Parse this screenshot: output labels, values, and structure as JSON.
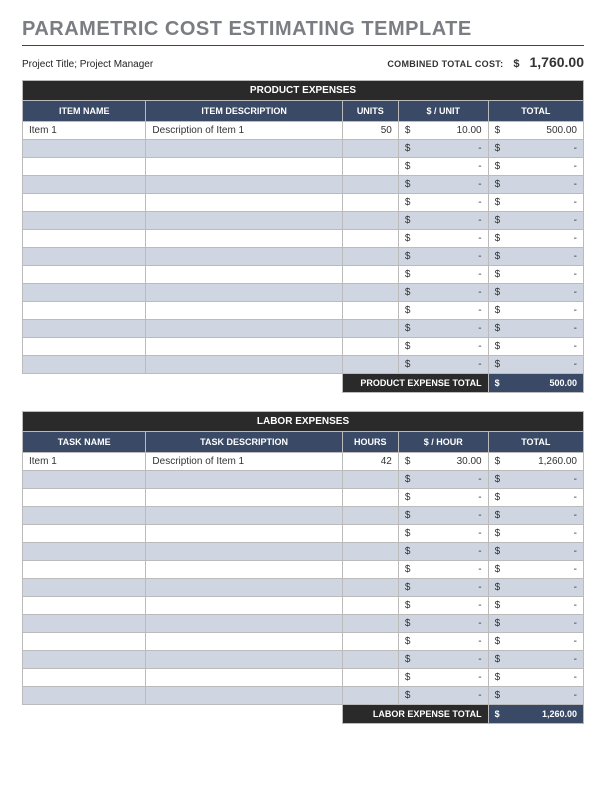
{
  "title": "PARAMETRIC COST ESTIMATING TEMPLATE",
  "meta": {
    "project_label": "Project Title; Project Manager",
    "combined_label": "COMBINED TOTAL COST:",
    "currency": "$",
    "combined_total": "1,760.00"
  },
  "sections": [
    {
      "section_title": "PRODUCT EXPENSES",
      "columns": [
        "ITEM NAME",
        "ITEM DESCRIPTION",
        "UNITS",
        "$ / UNIT",
        "TOTAL"
      ],
      "rows": [
        {
          "name": "Item 1",
          "desc": "Description of Item 1",
          "units": "50",
          "rate": "10.00",
          "total": "500.00"
        },
        {
          "name": "",
          "desc": "",
          "units": "",
          "rate": "-",
          "total": "-"
        },
        {
          "name": "",
          "desc": "",
          "units": "",
          "rate": "-",
          "total": "-"
        },
        {
          "name": "",
          "desc": "",
          "units": "",
          "rate": "-",
          "total": "-"
        },
        {
          "name": "",
          "desc": "",
          "units": "",
          "rate": "-",
          "total": "-"
        },
        {
          "name": "",
          "desc": "",
          "units": "",
          "rate": "-",
          "total": "-"
        },
        {
          "name": "",
          "desc": "",
          "units": "",
          "rate": "-",
          "total": "-"
        },
        {
          "name": "",
          "desc": "",
          "units": "",
          "rate": "-",
          "total": "-"
        },
        {
          "name": "",
          "desc": "",
          "units": "",
          "rate": "-",
          "total": "-"
        },
        {
          "name": "",
          "desc": "",
          "units": "",
          "rate": "-",
          "total": "-"
        },
        {
          "name": "",
          "desc": "",
          "units": "",
          "rate": "-",
          "total": "-"
        },
        {
          "name": "",
          "desc": "",
          "units": "",
          "rate": "-",
          "total": "-"
        },
        {
          "name": "",
          "desc": "",
          "units": "",
          "rate": "-",
          "total": "-"
        },
        {
          "name": "",
          "desc": "",
          "units": "",
          "rate": "-",
          "total": "-"
        }
      ],
      "total_label": "PRODUCT EXPENSE TOTAL",
      "total_value": "500.00"
    },
    {
      "section_title": "LABOR EXPENSES",
      "columns": [
        "TASK NAME",
        "TASK DESCRIPTION",
        "HOURS",
        "$ / HOUR",
        "TOTAL"
      ],
      "rows": [
        {
          "name": "Item 1",
          "desc": "Description of Item 1",
          "units": "42",
          "rate": "30.00",
          "total": "1,260.00"
        },
        {
          "name": "",
          "desc": "",
          "units": "",
          "rate": "-",
          "total": "-"
        },
        {
          "name": "",
          "desc": "",
          "units": "",
          "rate": "-",
          "total": "-"
        },
        {
          "name": "",
          "desc": "",
          "units": "",
          "rate": "-",
          "total": "-"
        },
        {
          "name": "",
          "desc": "",
          "units": "",
          "rate": "-",
          "total": "-"
        },
        {
          "name": "",
          "desc": "",
          "units": "",
          "rate": "-",
          "total": "-"
        },
        {
          "name": "",
          "desc": "",
          "units": "",
          "rate": "-",
          "total": "-"
        },
        {
          "name": "",
          "desc": "",
          "units": "",
          "rate": "-",
          "total": "-"
        },
        {
          "name": "",
          "desc": "",
          "units": "",
          "rate": "-",
          "total": "-"
        },
        {
          "name": "",
          "desc": "",
          "units": "",
          "rate": "-",
          "total": "-"
        },
        {
          "name": "",
          "desc": "",
          "units": "",
          "rate": "-",
          "total": "-"
        },
        {
          "name": "",
          "desc": "",
          "units": "",
          "rate": "-",
          "total": "-"
        },
        {
          "name": "",
          "desc": "",
          "units": "",
          "rate": "-",
          "total": "-"
        },
        {
          "name": "",
          "desc": "",
          "units": "",
          "rate": "-",
          "total": "-"
        }
      ],
      "total_label": "LABOR EXPENSE TOTAL",
      "total_value": "1,260.00"
    }
  ]
}
